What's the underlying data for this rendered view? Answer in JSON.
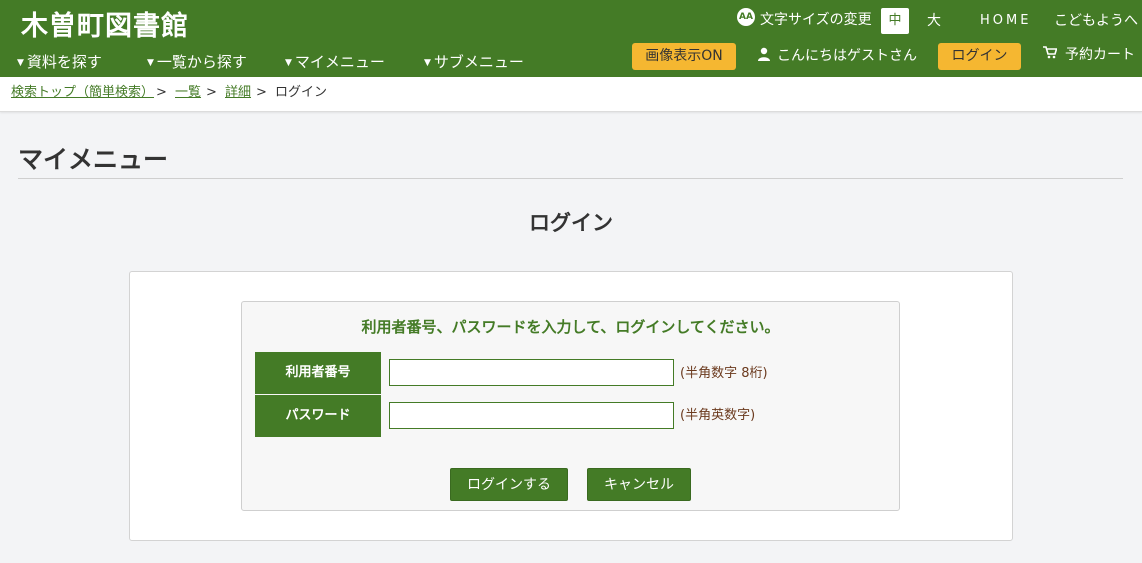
{
  "header": {
    "site_title": "木曽町図書館",
    "font_size_icon": "AA",
    "font_size_label": "文字サイズの変更",
    "font_size_mid": "中",
    "font_size_large": "大",
    "home": "HOME",
    "kids": "こどもようへ",
    "nav": [
      "資料を探す",
      "一覧から探す",
      "マイメニュー",
      "サブメニュー"
    ],
    "image_display_button": "画像表示ON",
    "greeting": "こんにちはゲストさん",
    "login_button": "ログイン",
    "cart": "予約カート"
  },
  "breadcrumb": {
    "items": [
      "検索トップ（簡単検索）",
      "一覧",
      "詳細",
      "ログイン"
    ],
    "separator": ">"
  },
  "page": {
    "heading": "マイメニュー",
    "login_title": "ログイン"
  },
  "form": {
    "instruction": "利用者番号、パスワードを入力して、ログインしてください。",
    "user_id_label": "利用者番号",
    "user_id_value": "",
    "user_id_hint": "(半角数字 8桁)",
    "password_label": "パスワード",
    "password_value": "",
    "password_hint": "(半角英数字)",
    "submit_button": "ログインする",
    "cancel_button": "キャンセル"
  },
  "colors": {
    "brand_green": "#447b26",
    "accent_yellow": "#f5b731",
    "background": "#f3f4f6"
  },
  "icons": {
    "font_size": "font-size-icon",
    "user": "user-icon",
    "cart": "cart-icon",
    "dropdown": "caret-down-icon"
  }
}
